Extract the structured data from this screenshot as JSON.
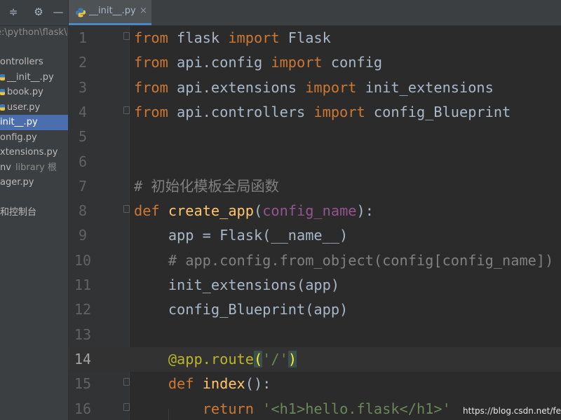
{
  "sidebar": {
    "toolbar_icons": [
      "collapse-icon",
      "gear-icon",
      "minimize-icon"
    ],
    "path": "e:\\python\\flask\\Pi",
    "tree": [
      {
        "label": "ontrollers",
        "icon": "folder"
      },
      {
        "label": "__init__.py",
        "icon": "python-file"
      },
      {
        "label": "book.py",
        "icon": "python-file"
      },
      {
        "label": "user.py",
        "icon": "python-file"
      },
      {
        "label": "init__.py",
        "icon": "none",
        "selected": true
      },
      {
        "label": "onfig.py",
        "icon": "none"
      },
      {
        "label": "xtensions.py",
        "icon": "none"
      },
      {
        "label": "nv",
        "extra": "library 根",
        "icon": "none"
      },
      {
        "label": "ager.py",
        "icon": "none"
      },
      {
        "label": "",
        "icon": "none"
      },
      {
        "label": "和控制台",
        "icon": "none"
      }
    ]
  },
  "tab": {
    "title": "__init__.py",
    "close_symbol": "×"
  },
  "editor": {
    "current_line": 14,
    "lines": [
      {
        "num": "1",
        "fold": true,
        "tokens": [
          {
            "t": "from",
            "c": "kw"
          },
          {
            "t": " flask "
          },
          {
            "t": "import",
            "c": "kw"
          },
          {
            "t": " Flask"
          }
        ]
      },
      {
        "num": "2",
        "fold": false,
        "tokens": [
          {
            "t": "from",
            "c": "kw"
          },
          {
            "t": " api.config "
          },
          {
            "t": "import",
            "c": "kw"
          },
          {
            "t": " config"
          }
        ]
      },
      {
        "num": "3",
        "fold": false,
        "tokens": [
          {
            "t": "from",
            "c": "kw"
          },
          {
            "t": " api.extensions "
          },
          {
            "t": "import",
            "c": "kw"
          },
          {
            "t": " init_extensions"
          }
        ]
      },
      {
        "num": "4",
        "fold": true,
        "tokens": [
          {
            "t": "from",
            "c": "kw"
          },
          {
            "t": " api.controllers "
          },
          {
            "t": "import",
            "c": "kw"
          },
          {
            "t": " config_Blueprint"
          }
        ]
      },
      {
        "num": "5",
        "fold": false,
        "tokens": []
      },
      {
        "num": "6",
        "fold": false,
        "tokens": []
      },
      {
        "num": "7",
        "fold": false,
        "tokens": [
          {
            "t": "# 初始化模板全局函数",
            "c": "cm"
          }
        ]
      },
      {
        "num": "8",
        "fold": true,
        "tokens": [
          {
            "t": "def",
            "c": "kw"
          },
          {
            "t": " "
          },
          {
            "t": "create_app",
            "c": "fn"
          },
          {
            "t": "("
          },
          {
            "t": "config_name",
            "c": "par"
          },
          {
            "t": "):"
          }
        ]
      },
      {
        "num": "9",
        "fold": false,
        "tokens": [
          {
            "t": "    app = Flask(__name__)"
          }
        ]
      },
      {
        "num": "10",
        "fold": false,
        "tokens": [
          {
            "t": "    # app.config.from_object(config[config_name])",
            "c": "cm"
          }
        ]
      },
      {
        "num": "11",
        "fold": false,
        "tokens": [
          {
            "t": "    init_extensions(app)"
          }
        ]
      },
      {
        "num": "12",
        "fold": false,
        "tokens": [
          {
            "t": "    config_Blueprint(app)"
          }
        ]
      },
      {
        "num": "13",
        "fold": false,
        "tokens": []
      },
      {
        "num": "14",
        "fold": false,
        "tokens": [
          {
            "t": "    "
          },
          {
            "t": "@app.route",
            "c": "dec"
          },
          {
            "t": "(",
            "c": "brm"
          },
          {
            "t": "'/'",
            "c": "str"
          },
          {
            "t": ")",
            "c": "brm"
          }
        ]
      },
      {
        "num": "15",
        "fold": true,
        "tokens": [
          {
            "t": "    "
          },
          {
            "t": "def",
            "c": "kw"
          },
          {
            "t": " "
          },
          {
            "t": "index",
            "c": "fn"
          },
          {
            "t": "():"
          }
        ]
      },
      {
        "num": "16",
        "fold": true,
        "tokens": [
          {
            "t": "        "
          },
          {
            "t": "return",
            "c": "kw"
          },
          {
            "t": " "
          },
          {
            "t": "'<h1>hello.flask</h1>'",
            "c": "str"
          }
        ]
      }
    ]
  },
  "watermark": "https://blog.csdn.net/fe"
}
